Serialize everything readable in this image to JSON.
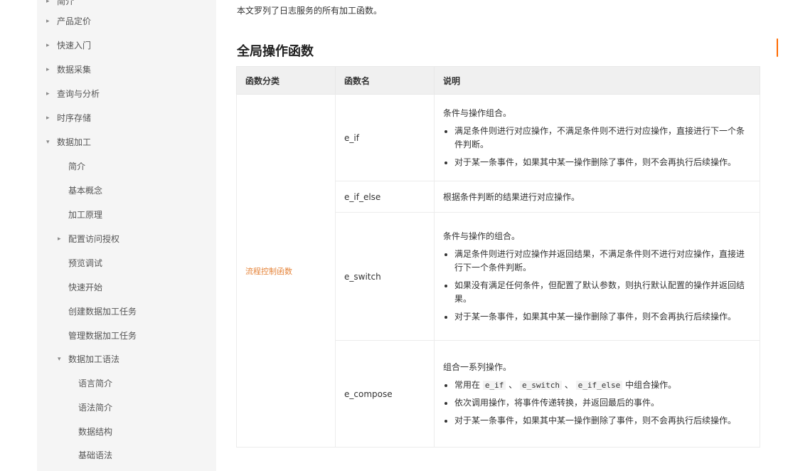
{
  "sidebar": {
    "items": [
      {
        "label": "简介",
        "arrow": true
      },
      {
        "label": "产品定价",
        "arrow": true
      },
      {
        "label": "快速入门",
        "arrow": true
      },
      {
        "label": "数据采集",
        "arrow": true
      },
      {
        "label": "查询与分析",
        "arrow": true
      },
      {
        "label": "时序存储",
        "arrow": true
      },
      {
        "label": "数据加工",
        "arrow": true
      },
      {
        "label": "简介",
        "arrow": false
      },
      {
        "label": "基本概念",
        "arrow": false
      },
      {
        "label": "加工原理",
        "arrow": false
      },
      {
        "label": "配置访问授权",
        "arrow": true
      },
      {
        "label": "预览调试",
        "arrow": false
      },
      {
        "label": "快速开始",
        "arrow": false
      },
      {
        "label": "创建数据加工任务",
        "arrow": false
      },
      {
        "label": "管理数据加工任务",
        "arrow": false
      },
      {
        "label": "数据加工语法",
        "arrow": true
      },
      {
        "label": "语言简介",
        "arrow": false
      },
      {
        "label": "语法简介",
        "arrow": false
      },
      {
        "label": "数据结构",
        "arrow": false
      },
      {
        "label": "基础语法",
        "arrow": false
      }
    ]
  },
  "main": {
    "intro": "本文罗列了日志服务的所有加工函数。",
    "section_title": "全局操作函数",
    "table": {
      "headers": [
        "函数分类",
        "函数名",
        "说明"
      ],
      "category": "流程控制函数",
      "rows": [
        {
          "name": "e_if",
          "summary": "条件与操作组合。",
          "bullets": [
            "满足条件则进行对应操作，不满足条件则不进行对应操作，直接进行下一个条件判断。",
            "对于某一条事件，如果其中某一操作删除了事件，则不会再执行后续操作。"
          ]
        },
        {
          "name": "e_if_else",
          "summary": "根据条件判断的结果进行对应操作。",
          "bullets": []
        },
        {
          "name": "e_switch",
          "summary": "条件与操作的组合。",
          "bullets": [
            "满足条件则进行对应操作并返回结果，不满足条件则不进行对应操作，直接进行下一个条件判断。",
            "如果没有满足任何条件，但配置了默认参数，则执行默认配置的操作并返回结果。",
            "对于某一条事件，如果其中某一操作删除了事件，则不会再执行后续操作。"
          ]
        },
        {
          "name": "e_compose",
          "summary": "组合一系列操作。",
          "bullets_rich": {
            "b1_prefix": "常用在",
            "b1_code1": "e_if",
            "b1_sep1": "、",
            "b1_code2": "e_switch",
            "b1_sep2": "、",
            "b1_code3": "e_if_else",
            "b1_suffix": "中组合操作。",
            "b2": "依次调用操作，将事件传递转换，并返回最后的事件。",
            "b3": "对于某一条事件，如果其中某一操作删除了事件，则不会再执行后续操作。"
          }
        }
      ]
    }
  },
  "colors": {
    "sidebar_bg": "#f5f5f5",
    "accent": "#ff6a00",
    "category_text": "#e5843a",
    "header_bg": "#f0f0f0"
  }
}
